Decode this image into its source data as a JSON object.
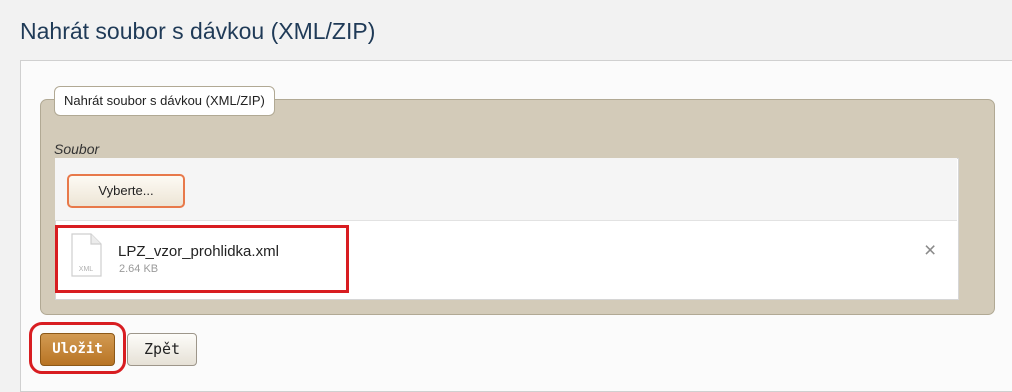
{
  "page": {
    "title": "Nahrát soubor s dávkou (XML/ZIP)"
  },
  "fieldset": {
    "legend": "Nahrát soubor s dávkou (XML/ZIP)",
    "field_label": "Soubor"
  },
  "upload": {
    "select_label": "Vyberte...",
    "file": {
      "name": "LPZ_vzor_prohlidka.xml",
      "size": "2.64 KB",
      "icon_text": "XML",
      "icon": "file-document-icon"
    },
    "remove_icon": "×"
  },
  "actions": {
    "save_label": "Uložit",
    "back_label": "Zpět"
  },
  "colors": {
    "highlight": "#d81d21",
    "save_button": "#c4853a",
    "fieldset_bg": "#d3cbb9",
    "title": "#1f3a57"
  }
}
